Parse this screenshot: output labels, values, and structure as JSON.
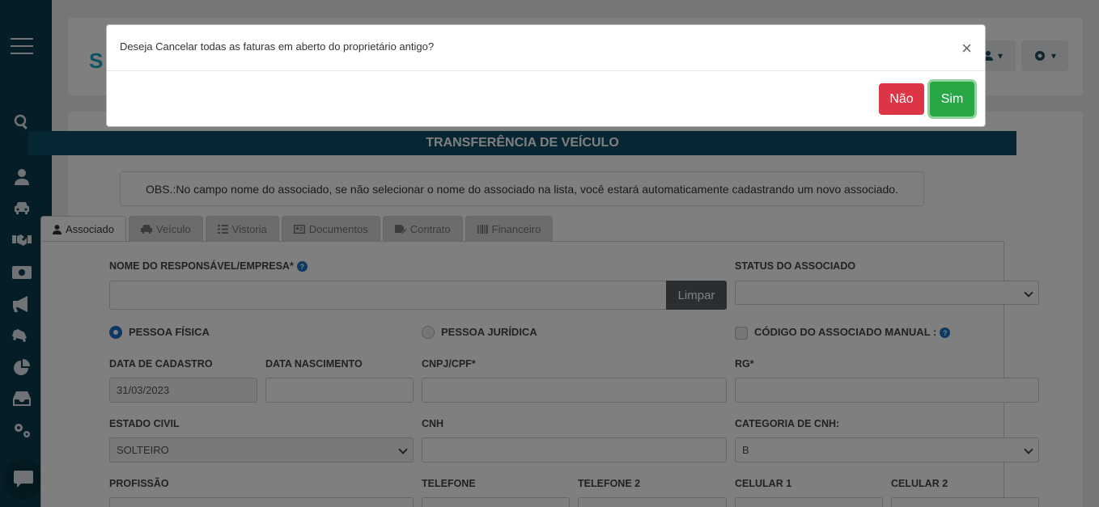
{
  "modal": {
    "message": "Deseja Cancelar todas as faturas em aberto do proprietário antigo?",
    "close_label": "×",
    "no_label": "Não",
    "yes_label": "Sim"
  },
  "page": {
    "title": "TRANSFERÊNCIA DE VEÍCULO",
    "obs": "OBS.:No campo nome do associado, se não selecionar o nome do associado na lista, você estará automaticamente cadastrando um novo associado.",
    "tabs": [
      {
        "label": "Associado",
        "icon": "user-icon"
      },
      {
        "label": "Veículo",
        "icon": "car-icon"
      },
      {
        "label": "Vistoria",
        "icon": "checklist-icon"
      },
      {
        "label": "Documentos",
        "icon": "id-card-icon"
      },
      {
        "label": "Contrato",
        "icon": "signature-icon"
      },
      {
        "label": "Financeiro",
        "icon": "barcode-icon"
      }
    ]
  },
  "form": {
    "nome_label": "NOME DO RESPONSÁVEL/EMPRESA*",
    "limpar_label": "Limpar",
    "status_label": "STATUS DO ASSOCIADO",
    "pessoa_fisica": "PESSOA FÍSICA",
    "pessoa_juridica": "PESSOA JURÍDICA",
    "codigo_manual": "CÓDIGO DO ASSOCIADO MANUAL :",
    "data_cadastro_label": "DATA DE CADASTRO",
    "data_cadastro_value": "31/03/2023",
    "data_nascimento_label": "DATA NASCIMENTO",
    "cnpj_label": "CNPJ/CPF*",
    "rg_label": "RG*",
    "estado_civil_label": "ESTADO CIVIL",
    "estado_civil_value": "SOLTEIRO",
    "cnh_label": "CNH",
    "categoria_cnh_label": "CATEGORIA DE CNH:",
    "categoria_cnh_value": "B",
    "profissao_label": "PROFISSÃO",
    "telefone_label": "TELEFONE",
    "telefone2_label": "TELEFONE 2",
    "celular1_label": "CELULAR 1",
    "celular2_label": "CELULAR 2"
  },
  "colors": {
    "sidebar": "#0a3a4f",
    "title_bar": "#0d4c66",
    "no_button": "#dc3545",
    "yes_button": "#28a745"
  }
}
